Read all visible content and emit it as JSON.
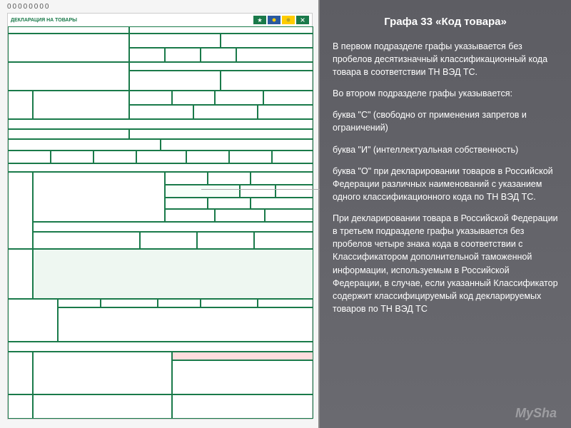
{
  "page_number": "00000000",
  "form": {
    "title": "ДЕКЛАРАЦИЯ НА ТОВАРЫ",
    "flag_icons": [
      "emblem-1",
      "emblem-2",
      "emblem-3",
      "emblem-4"
    ]
  },
  "explanation": {
    "title": "Графа 33 «Код товара»",
    "paragraphs": [
      "В первом подразделе графы указывается без пробелов десятизначный классификационный кода товара в соответствии ТН ВЭД ТС.",
      "Во втором подразделе графы указывается:",
      "буква \"С\" (свободно от применения запретов и ограничений)",
      "буква \"И\" (интеллектуальная собственность)",
      "буква \"О\" при декларировании товаров в Российской Федерации различных наименований с указанием одного классификационного кода по ТН ВЭД ТС.",
      "При декларировании товара в Российской Федерации в третьем подразделе графы указывается без пробелов четыре знака кода в соответствии с Классификатором дополнительной таможенной информации, используемым в Российской Федерации, в случае, если указанный Классификатор содержит классифицируемый код декларируемых товаров по ТН ВЭД ТС"
    ]
  },
  "watermark": "MySha",
  "colors": {
    "form_green": "#1a7a4a",
    "panel_bg": "#5d5d63"
  }
}
